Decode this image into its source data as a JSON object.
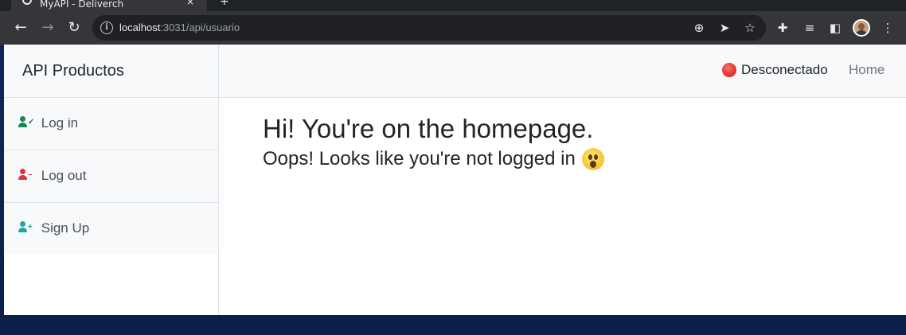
{
  "browser": {
    "tab_title": "MyAPI - Deliverch",
    "tab_close": "×",
    "new_tab": "+",
    "url_host": "localhost",
    "url_path": ":3031/api/usuario"
  },
  "sidebar": {
    "title": "API Productos",
    "items": [
      {
        "label": "Log in",
        "icon": "user-check-icon",
        "color": "#198754"
      },
      {
        "label": "Log out",
        "icon": "user-minus-icon",
        "color": "#dc3545"
      },
      {
        "label": "Sign Up",
        "icon": "user-plus-icon",
        "color": "#20a4a4"
      }
    ]
  },
  "navbar": {
    "status_label": "Desconectado",
    "status_color": "#e53935",
    "home_label": "Home"
  },
  "main": {
    "heading": "Hi! You're on the homepage.",
    "subheading": "Oops! Looks like you're not logged in",
    "emoji": "astonished-face-emoji"
  }
}
